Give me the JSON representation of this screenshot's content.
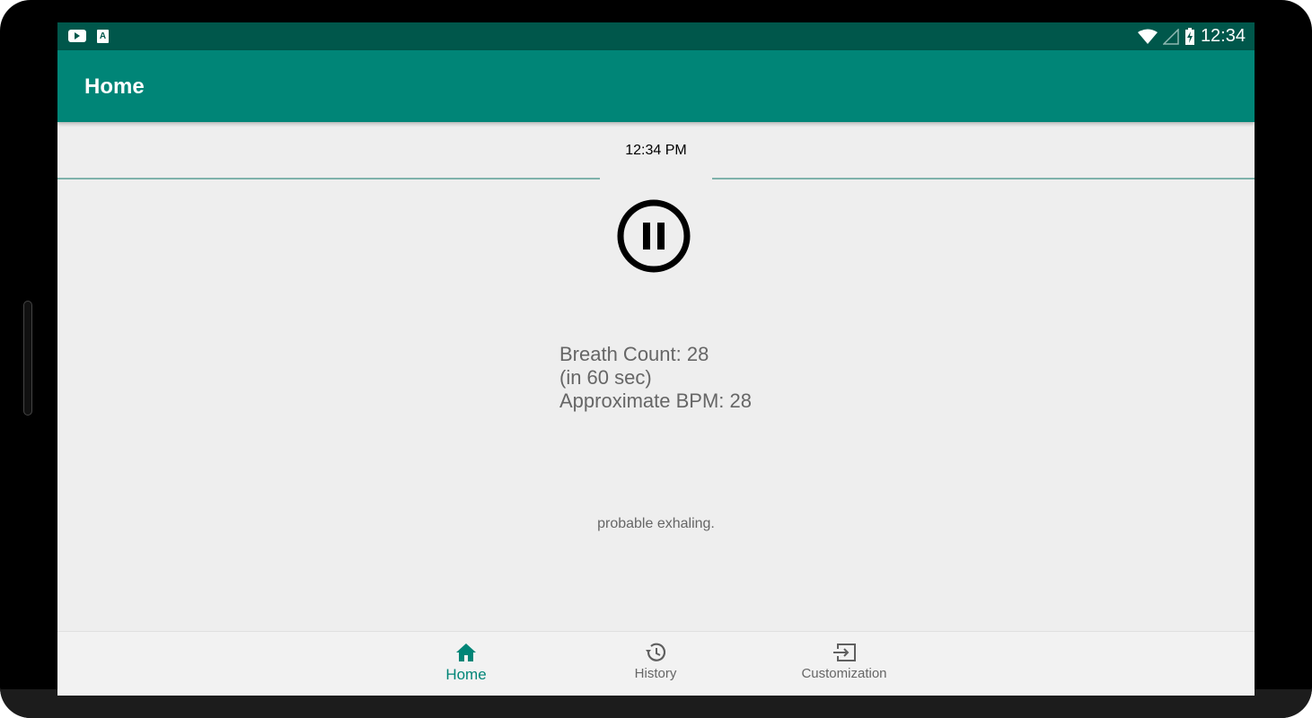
{
  "status_bar": {
    "time": "12:34",
    "icons": [
      "youtube-icon",
      "a-icon",
      "wifi-icon",
      "signal-icon",
      "battery-charging-icon"
    ]
  },
  "app_bar": {
    "title": "Home"
  },
  "main": {
    "time_label": "12:34 PM",
    "pause_icon": "pause-circle-icon",
    "breath_count_line": "Breath Count: 28",
    "duration_line": "(in 60 sec)",
    "bpm_line": "Approximate BPM: 28",
    "status_message": "probable exhaling."
  },
  "bottom_nav": {
    "items": [
      {
        "label": "Home",
        "icon": "home-icon",
        "active": true
      },
      {
        "label": "History",
        "icon": "history-icon",
        "active": false
      },
      {
        "label": "Customization",
        "icon": "input-icon",
        "active": false
      }
    ]
  },
  "colors": {
    "primary": "#008577",
    "primary_dark": "#00574B",
    "background": "#EEEEEE",
    "text_secondary": "#666666"
  }
}
